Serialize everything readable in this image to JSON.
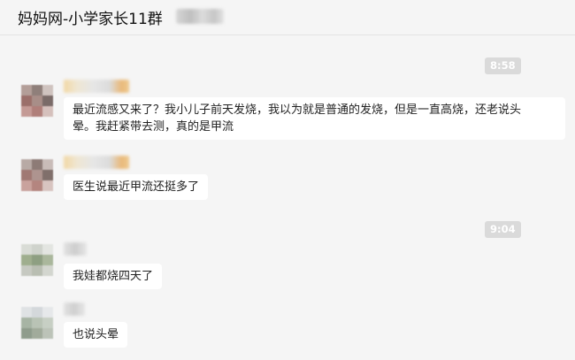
{
  "header": {
    "title": "妈妈网-小学家长11群"
  },
  "timestamps": [
    "8:58",
    "9:04"
  ],
  "messages": [
    {
      "lines": [
        "最近流感又来了？我小儿子前天发烧，我以为就是普通的发烧，但是一直高烧，还老说头",
        "晕。我赶紧带去测，真的是甲流"
      ]
    },
    {
      "lines": [
        "医生说最近甲流还挺多了"
      ]
    },
    {
      "lines": [
        "我娃都烧四天了"
      ]
    },
    {
      "lines": [
        "也说头晕"
      ]
    }
  ]
}
